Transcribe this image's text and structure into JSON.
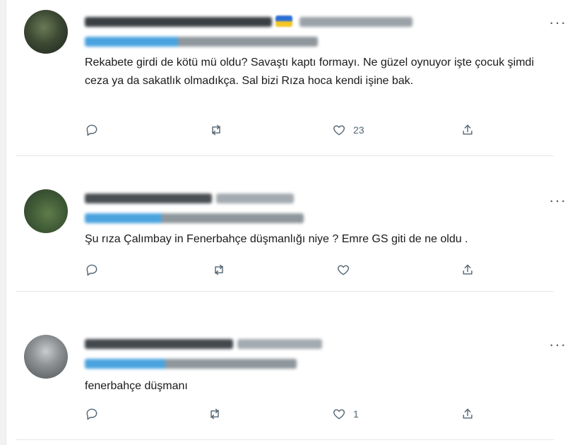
{
  "tweets": [
    {
      "text": "Rekabete girdi de kötü mü oldu? Savaştı kaptı formayı. Ne güzel oynuyor işte çocuk şimdi ceza ya da sakatlık olmadıkça. Sal bizi Rıza hoca kendi işine bak.",
      "like_count": "23",
      "more_label": "···",
      "icons": [
        "reply-icon",
        "retweet-icon",
        "like-icon",
        "share-icon"
      ]
    },
    {
      "text": "Şu rıza Çalımbay in Fenerbahçe düşmanlığı niye ? Emre GS giti de ne oldu .",
      "like_count": "",
      "more_label": "···",
      "icons": [
        "reply-icon",
        "retweet-icon",
        "like-icon",
        "share-icon"
      ]
    },
    {
      "text": "fenerbahçe düşmanı",
      "like_count": "1",
      "more_label": "···",
      "icons": [
        "reply-icon",
        "retweet-icon",
        "like-icon",
        "share-icon"
      ]
    }
  ],
  "colors": {
    "text": "#1a1a1a",
    "icon": "#536471",
    "separator": "#e3e6e8",
    "blur_name": "#3a3f44",
    "blur_handle": "#4aa3df"
  }
}
